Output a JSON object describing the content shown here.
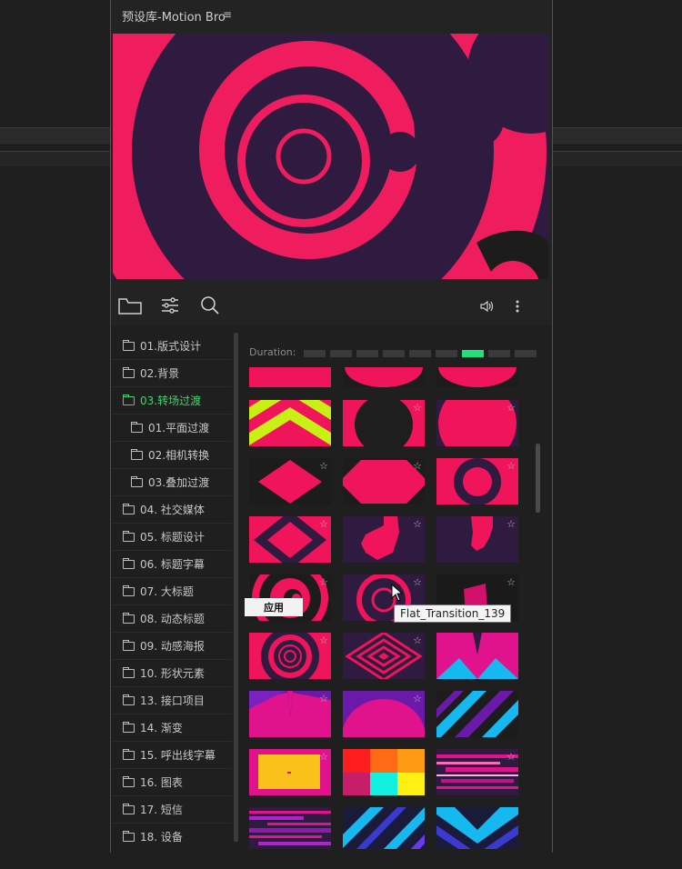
{
  "panel": {
    "title": "预设库-Motion Bro",
    "menu_glyph": "≡"
  },
  "toolbar": {
    "icons": [
      "folder-icon",
      "sliders-icon",
      "search-icon",
      "volume-icon",
      "more-icon"
    ]
  },
  "duration": {
    "label": "Duration:",
    "segments": 9,
    "active_segment": 6
  },
  "sidebar": {
    "items": [
      {
        "label": "01.版式设计",
        "level": 0
      },
      {
        "label": "02.背景",
        "level": 0
      },
      {
        "label": "03.转场过渡",
        "level": 0,
        "active": true
      },
      {
        "label": "01.平面过渡",
        "level": 1
      },
      {
        "label": "02.相机转换",
        "level": 1
      },
      {
        "label": "03.叠加过渡",
        "level": 1
      },
      {
        "label": "04. 社交媒体",
        "level": 0
      },
      {
        "label": "05. 标题设计",
        "level": 0
      },
      {
        "label": "06. 标题字幕",
        "level": 0
      },
      {
        "label": "07. 大标题",
        "level": 0
      },
      {
        "label": "08. 动态标题",
        "level": 0
      },
      {
        "label": "09. 动感海报",
        "level": 0
      },
      {
        "label": "10. 形状元素",
        "level": 0
      },
      {
        "label": "13. 接口项目",
        "level": 0
      },
      {
        "label": "14. 渐变",
        "level": 0
      },
      {
        "label": "15. 呼出线字幕",
        "level": 0
      },
      {
        "label": "16. 图表",
        "level": 0
      },
      {
        "label": "17. 短信",
        "level": 0
      },
      {
        "label": "18. 设备",
        "level": 0
      }
    ]
  },
  "apply_button": {
    "label": "应用"
  },
  "tooltip": {
    "text": "Flat_Transition_139"
  },
  "colors": {
    "accent": "#39d96a",
    "duration_active": "#1fe07a",
    "pink": "#f0145a",
    "purple": "#2e1b3f",
    "magenta": "#e0128c",
    "border": "#2f5a8a"
  }
}
